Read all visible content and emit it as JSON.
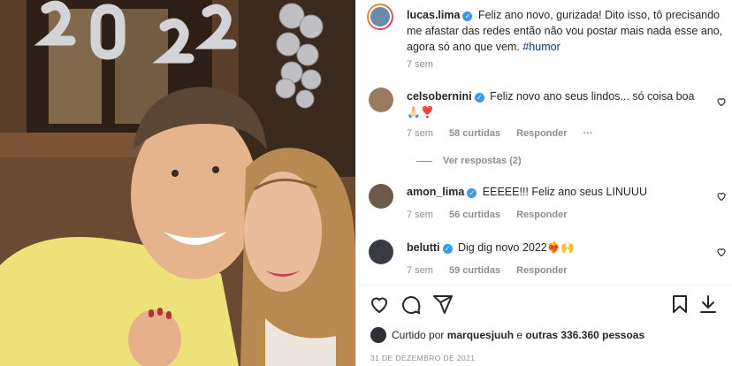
{
  "post": {
    "author": "lucas.lima",
    "caption_main": "Feliz ano novo, gurizada! Dito isso, tô precisando me afastar das redes então não vou postar mais nada esse ano, agora só ano que vem.",
    "hashtag": "#humor",
    "time": "7 sem",
    "photo_balloon_text": "2022"
  },
  "comments": [
    {
      "user": "celsobernini",
      "text": "Feliz novo ano seus lindos... só coisa boa 🙏🏻❣️",
      "time": "7 sem",
      "likes": "58 curtidas",
      "reply": "Responder",
      "more": "···"
    },
    {
      "user": "amon_lima",
      "text": "EEEEE!!! Feliz ano seus LINUUU",
      "time": "7 sem",
      "likes": "56 curtidas",
      "reply": "Responder"
    },
    {
      "user": "belutti",
      "text": "Dig dig novo 2022❤️‍🔥🙌",
      "time": "7 sem",
      "likes": "59 curtidas",
      "reply": "Responder"
    }
  ],
  "view_replies": "Ver respostas (2)",
  "likes_line": {
    "prefix": "Curtido por ",
    "user": "marquesjuuh",
    "middle": " e ",
    "others": "outras 336.360 pessoas"
  },
  "date": "31 DE DEZEMBRO DE 2021",
  "icons": {
    "like": "heart-icon",
    "comment": "comment-icon",
    "share": "send-icon",
    "save": "bookmark-icon",
    "download": "download-icon",
    "verified": "verified-badge-icon"
  },
  "colors": {
    "verified": "#3897f0",
    "link": "#00376b",
    "muted": "#8e8e8e"
  }
}
